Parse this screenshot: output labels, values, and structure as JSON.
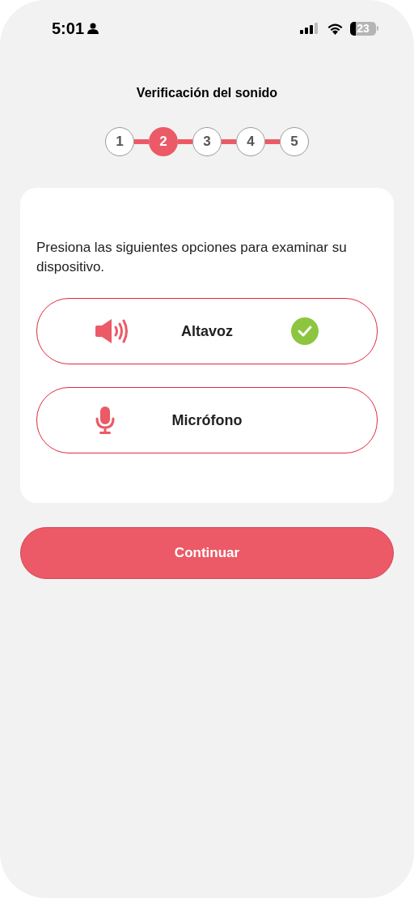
{
  "status_bar": {
    "time": "5:01",
    "battery": "23"
  },
  "title": "Verificación del sonido",
  "steps": [
    {
      "label": "1",
      "selected": false
    },
    {
      "label": "2",
      "selected": true
    },
    {
      "label": "3",
      "selected": false
    },
    {
      "label": "4",
      "selected": false
    },
    {
      "label": "5",
      "selected": false
    }
  ],
  "card": {
    "instructions": "Presiona las siguientes opciones para examinar su dispositivo.",
    "options": [
      {
        "kind": "speaker",
        "label": "Altavoz",
        "checked": true
      },
      {
        "kind": "microphone",
        "label": "Micrófono",
        "checked": false
      }
    ]
  },
  "continue_button": "Continuar"
}
